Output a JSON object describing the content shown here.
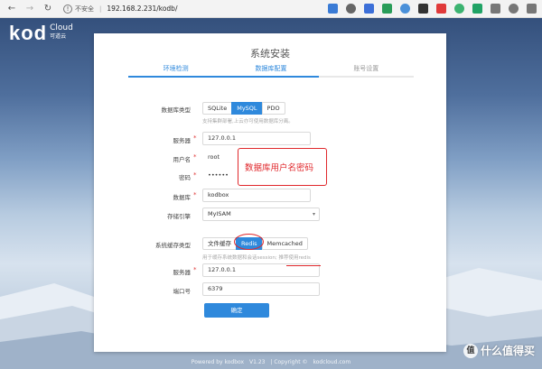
{
  "browser": {
    "back_icon": "←",
    "forward_icon": "→",
    "reload_icon": "↻",
    "warning_icon": "!",
    "insecure_label": "不安全",
    "separator": "|",
    "url": "192.168.2.231/kodb/",
    "extensions": [
      {
        "name": "zoom-icon",
        "color": "#3a7bd5"
      },
      {
        "name": "star-icon",
        "color": "#666"
      },
      {
        "name": "translate-icon",
        "color": "#3c6fd8"
      },
      {
        "name": "chat-extension-icon",
        "color": "#2a9d59"
      },
      {
        "name": "cloud-extension-icon",
        "color": "#4a90d9"
      },
      {
        "name": "dark-extension-icon",
        "color": "#333"
      },
      {
        "name": "red-circle-extension-icon",
        "color": "#e03a3a"
      },
      {
        "name": "shield-extension-icon",
        "color": "#3cb371"
      },
      {
        "name": "green-extension-icon",
        "color": "#21a366"
      },
      {
        "name": "puzzle-icon",
        "color": "#777"
      },
      {
        "name": "favorites-icon",
        "color": "#777"
      },
      {
        "name": "collections-icon",
        "color": "#777"
      }
    ]
  },
  "logo": {
    "brand": "kod",
    "cloud": "Cloud",
    "subtitle": "可道云"
  },
  "card": {
    "title": "系统安装",
    "steps": [
      "环境检测",
      "数据库配置",
      "账号设置"
    ],
    "db_type": {
      "label": "数据库类型",
      "options": [
        "SQLite",
        "MySQL",
        "PDO"
      ],
      "selected": "MySQL",
      "hint": "支持集群部署,上云亦可使用数据库分离。"
    },
    "server": {
      "label": "服务器",
      "value": "127.0.0.1"
    },
    "username": {
      "label": "用户名",
      "value": "root"
    },
    "password": {
      "label": "密码",
      "value": "••••••"
    },
    "database": {
      "label": "数据库",
      "value": "kodbox"
    },
    "engine": {
      "label": "存储引擎",
      "value": "MyISAM"
    },
    "cache_type": {
      "label": "系统缓存类型",
      "options": [
        "文件缓存",
        "Redis",
        "Memcached"
      ],
      "selected": "Redis",
      "hint": "用于缓存系统数据和会话session; 推荐使用redis"
    },
    "cache_server": {
      "label": "服务器",
      "value": "127.0.0.1"
    },
    "port": {
      "label": "端口号",
      "value": "6379"
    },
    "confirm_label": "确定",
    "required_mark": "*",
    "select_arrow": "▾"
  },
  "annotation": {
    "text": "数据库用户名密码",
    "color": "#e0282c"
  },
  "footer": {
    "powered": "Powered by kodbox",
    "version": "V1.23",
    "copyright": "| Copyright ©",
    "site": "kodcloud.com"
  },
  "watermark": {
    "logo_char": "值",
    "text": "什么值得买"
  }
}
